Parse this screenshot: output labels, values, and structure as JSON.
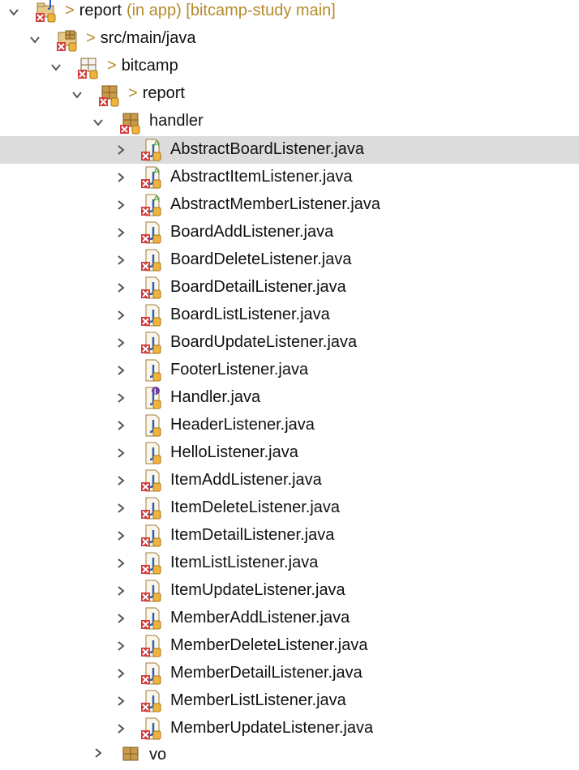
{
  "explorer": {
    "project": {
      "label": "report",
      "suffix": "(in app) [bitcamp-study main]",
      "deco": ">"
    },
    "source_folder": {
      "label": "src/main/java",
      "deco": ">"
    },
    "pkg_bitcamp": {
      "label": "bitcamp",
      "deco": ">"
    },
    "pkg_report": {
      "label": "report",
      "deco": ">"
    },
    "pkg_handler": {
      "label": "handler"
    },
    "files": [
      {
        "label": "AbstractBoardListener.java",
        "kind": "abstract-class",
        "error": true,
        "selected": true
      },
      {
        "label": "AbstractItemListener.java",
        "kind": "abstract-class",
        "error": true
      },
      {
        "label": "AbstractMemberListener.java",
        "kind": "abstract-class",
        "error": true
      },
      {
        "label": "BoardAddListener.java",
        "kind": "class",
        "error": true
      },
      {
        "label": "BoardDeleteListener.java",
        "kind": "class",
        "error": true
      },
      {
        "label": "BoardDetailListener.java",
        "kind": "class",
        "error": true
      },
      {
        "label": "BoardListListener.java",
        "kind": "class",
        "error": true
      },
      {
        "label": "BoardUpdateListener.java",
        "kind": "class",
        "error": true
      },
      {
        "label": "FooterListener.java",
        "kind": "class",
        "error": false
      },
      {
        "label": "Handler.java",
        "kind": "interface",
        "error": false
      },
      {
        "label": "HeaderListener.java",
        "kind": "class",
        "error": false
      },
      {
        "label": "HelloListener.java",
        "kind": "class",
        "error": false
      },
      {
        "label": "ItemAddListener.java",
        "kind": "class",
        "error": true
      },
      {
        "label": "ItemDeleteListener.java",
        "kind": "class",
        "error": true
      },
      {
        "label": "ItemDetailListener.java",
        "kind": "class",
        "error": true
      },
      {
        "label": "ItemListListener.java",
        "kind": "class",
        "error": true
      },
      {
        "label": "ItemUpdateListener.java",
        "kind": "class",
        "error": true
      },
      {
        "label": "MemberAddListener.java",
        "kind": "class",
        "error": true
      },
      {
        "label": "MemberDeleteListener.java",
        "kind": "class",
        "error": true
      },
      {
        "label": "MemberDetailListener.java",
        "kind": "class",
        "error": true
      },
      {
        "label": "MemberListListener.java",
        "kind": "class",
        "error": true
      },
      {
        "label": "MemberUpdateListener.java",
        "kind": "class",
        "error": true
      }
    ],
    "pkg_vo": {
      "label": "vo"
    },
    "colors": {
      "selection": "#dcdcdc",
      "decoration": "#b58a2a",
      "error": "#d23c3c",
      "java_blue": "#2a5bb8",
      "abstract_green": "#3d9a3d"
    }
  }
}
